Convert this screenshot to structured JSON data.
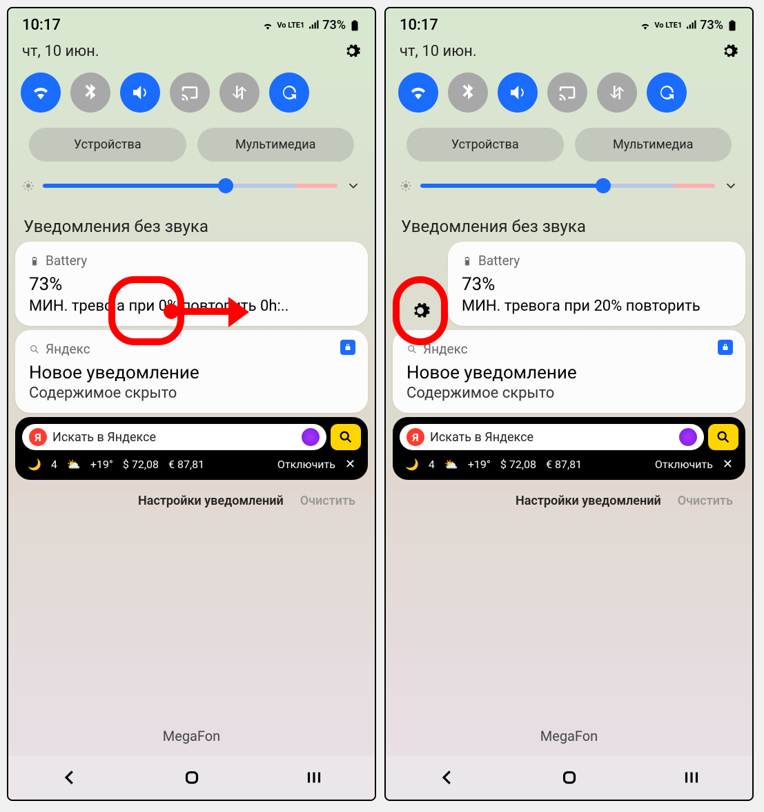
{
  "status": {
    "time": "10:17",
    "battery_pct": "73%",
    "net_label": "Vo LTE1"
  },
  "date": "чт, 10 июн.",
  "toggles": [
    {
      "name": "wifi",
      "on": true
    },
    {
      "name": "bluetooth",
      "on": false
    },
    {
      "name": "sound",
      "on": true
    },
    {
      "name": "cast",
      "on": false
    },
    {
      "name": "data-transfer",
      "on": false
    },
    {
      "name": "rotate",
      "on": true
    }
  ],
  "pills": {
    "devices": "Устройства",
    "media": "Мультимедиа"
  },
  "sections": {
    "silent": "Уведомления без звука"
  },
  "notif_battery": {
    "app": "Battery",
    "title": "73%",
    "body_left": "МИН. трево а при 0% повторить 0h:..",
    "body_right": "МИН. тревога при 20% повторить"
  },
  "notif_yandex": {
    "app": "Яндекс",
    "title": "Новое уведомление",
    "body": "Содержимое скрыто"
  },
  "yandex_widget": {
    "search_placeholder": "Искать в Яндексе",
    "weather_count": "4",
    "temp": "+19°",
    "usd": "72,08",
    "eur": "87,81",
    "disable": "Отключить"
  },
  "actions": {
    "settings": "Настройки уведомлений",
    "clear": "Очистить"
  },
  "carrier": "MegaFon"
}
